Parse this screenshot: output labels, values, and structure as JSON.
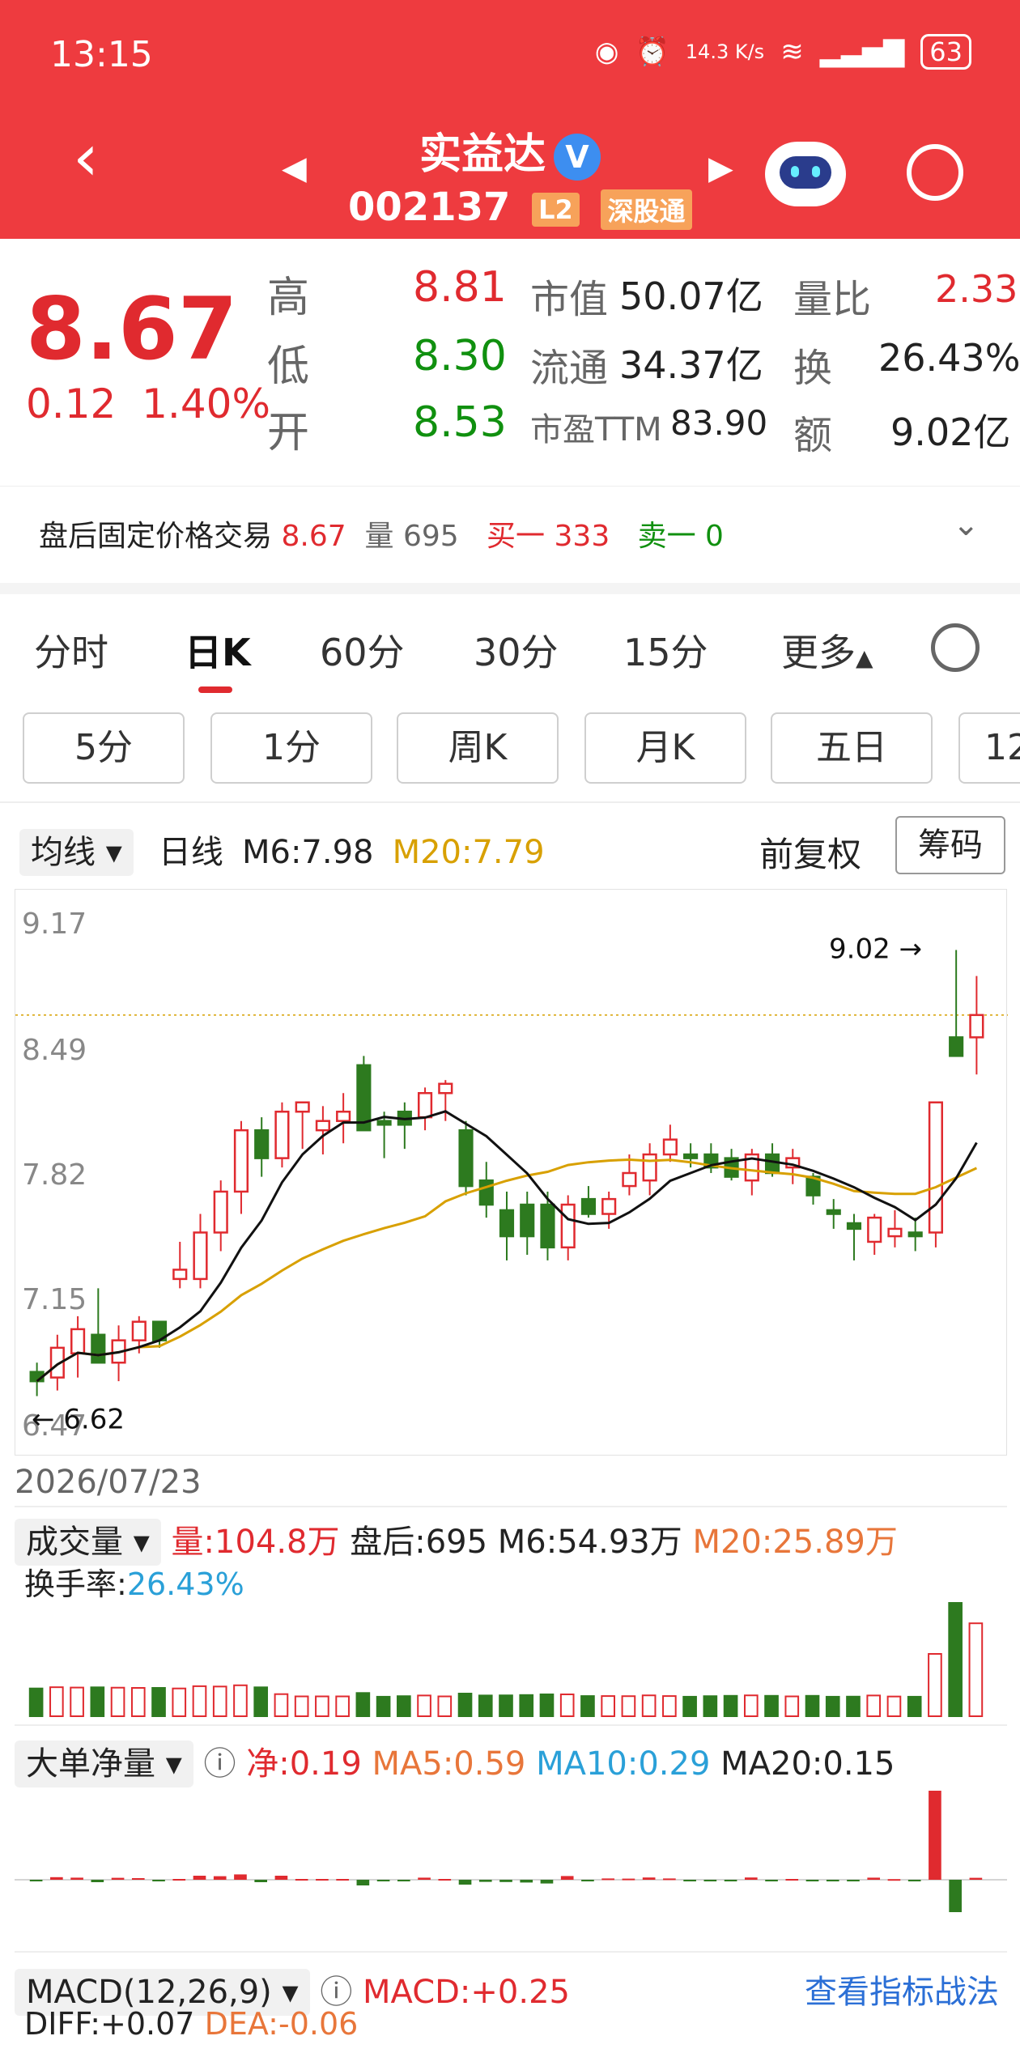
{
  "status_bar": {
    "time": "13:15",
    "network_speed": "14.3 K/s",
    "battery": "63"
  },
  "header": {
    "name": "实益达",
    "code": "002137",
    "tag_l2": "L2",
    "tag_connect": "深股通"
  },
  "quote": {
    "price": "8.67",
    "change": "0.12",
    "change_pct": "1.40%",
    "high_label": "高",
    "high": "8.81",
    "low_label": "低",
    "low": "8.30",
    "open_label": "开",
    "open": "8.53",
    "mcap_label": "市值",
    "mcap": "50.07亿",
    "float_label": "流通",
    "float": "34.37亿",
    "pe_label": "市盈TTM",
    "pe": "83.90",
    "vol_ratio_label": "量比",
    "vol_ratio": "2.33",
    "turnover_label": "换",
    "turnover": "26.43%",
    "amount_label": "额",
    "amount": "9.02亿"
  },
  "after_hours": {
    "label": "盘后固定价格交易",
    "price": "8.67",
    "vol_label": "量",
    "vol": "695",
    "buy1_label": "买一",
    "buy1": "333",
    "sell1_label": "卖一",
    "sell1": "0"
  },
  "tabs": [
    "分时",
    "日K",
    "60分",
    "30分",
    "15分",
    "更多"
  ],
  "subtabs": [
    "5分",
    "1分",
    "周K",
    "月K",
    "五日",
    "12"
  ],
  "kline": {
    "ma_dropdown": "均线",
    "line_type": "日线",
    "m6": "M6:7.98",
    "m20": "M20:7.79",
    "adjust": "前复权",
    "chip_btn": "筹码",
    "y_ticks": [
      "9.17",
      "8.49",
      "7.82",
      "7.15",
      "6.47"
    ],
    "high_mark": "9.02",
    "low_mark": "6.62",
    "date": "2026/07/23",
    "colors": {
      "up": "#e02a2f",
      "down": "#2d7a1f",
      "ma6": "#111111",
      "ma20": "#d8a000"
    }
  },
  "volume": {
    "dropdown": "成交量",
    "vol": "量:104.8万",
    "after": "盘后:695",
    "m6": "M6:54.93万",
    "m20": "M20:25.89万",
    "turnover_label": "换手率:",
    "turnover": "26.43%"
  },
  "bigorder": {
    "dropdown": "大单净量",
    "net": "净:0.19",
    "ma5": "MA5:0.59",
    "ma10": "MA10:0.29",
    "ma20": "MA20:0.15"
  },
  "macd": {
    "dropdown": "MACD(12,26,9)",
    "value": "MACD:+0.25",
    "link": "查看指标战法",
    "diff": "DIFF:+0.07",
    "dea": "DEA:-0.06"
  },
  "chart_data": {
    "type": "candlestick",
    "series": [
      {
        "o": 6.75,
        "h": 6.8,
        "l": 6.62,
        "c": 6.7
      },
      {
        "o": 6.72,
        "h": 6.95,
        "l": 6.65,
        "c": 6.88
      },
      {
        "o": 6.85,
        "h": 7.05,
        "l": 6.72,
        "c": 6.98
      },
      {
        "o": 6.95,
        "h": 7.2,
        "l": 6.8,
        "c": 6.8
      },
      {
        "o": 6.8,
        "h": 7.0,
        "l": 6.7,
        "c": 6.92
      },
      {
        "o": 6.92,
        "h": 7.05,
        "l": 6.85,
        "c": 7.02
      },
      {
        "o": 7.02,
        "h": 7.0,
        "l": 6.88,
        "c": 6.92
      },
      {
        "o": 7.25,
        "h": 7.45,
        "l": 7.2,
        "c": 7.3
      },
      {
        "o": 7.25,
        "h": 7.6,
        "l": 7.2,
        "c": 7.5
      },
      {
        "o": 7.5,
        "h": 7.78,
        "l": 7.4,
        "c": 7.72
      },
      {
        "o": 7.72,
        "h": 8.1,
        "l": 7.6,
        "c": 8.05
      },
      {
        "o": 8.05,
        "h": 8.12,
        "l": 7.8,
        "c": 7.9
      },
      {
        "o": 7.9,
        "h": 8.2,
        "l": 7.85,
        "c": 8.15
      },
      {
        "o": 8.15,
        "h": 8.2,
        "l": 7.95,
        "c": 8.2
      },
      {
        "o": 8.05,
        "h": 8.18,
        "l": 7.92,
        "c": 8.1
      },
      {
        "o": 8.1,
        "h": 8.25,
        "l": 7.98,
        "c": 8.15
      },
      {
        "o": 8.4,
        "h": 8.45,
        "l": 8.05,
        "c": 8.05
      },
      {
        "o": 8.1,
        "h": 8.15,
        "l": 7.9,
        "c": 8.08
      },
      {
        "o": 8.15,
        "h": 8.2,
        "l": 7.95,
        "c": 8.08
      },
      {
        "o": 8.12,
        "h": 8.28,
        "l": 8.05,
        "c": 8.25
      },
      {
        "o": 8.25,
        "h": 8.32,
        "l": 8.1,
        "c": 8.3
      },
      {
        "o": 8.05,
        "h": 8.1,
        "l": 7.7,
        "c": 7.75
      },
      {
        "o": 7.78,
        "h": 7.88,
        "l": 7.58,
        "c": 7.65
      },
      {
        "o": 7.62,
        "h": 7.72,
        "l": 7.35,
        "c": 7.48
      },
      {
        "o": 7.65,
        "h": 7.72,
        "l": 7.38,
        "c": 7.48
      },
      {
        "o": 7.65,
        "h": 7.72,
        "l": 7.35,
        "c": 7.42
      },
      {
        "o": 7.42,
        "h": 7.7,
        "l": 7.35,
        "c": 7.65
      },
      {
        "o": 7.68,
        "h": 7.75,
        "l": 7.58,
        "c": 7.6
      },
      {
        "o": 7.6,
        "h": 7.72,
        "l": 7.52,
        "c": 7.68
      },
      {
        "o": 7.75,
        "h": 7.92,
        "l": 7.7,
        "c": 7.82
      },
      {
        "o": 7.78,
        "h": 7.98,
        "l": 7.7,
        "c": 7.92
      },
      {
        "o": 7.92,
        "h": 8.08,
        "l": 7.88,
        "c": 8.0
      },
      {
        "o": 7.92,
        "h": 7.98,
        "l": 7.85,
        "c": 7.9
      },
      {
        "o": 7.92,
        "h": 7.98,
        "l": 7.82,
        "c": 7.85
      },
      {
        "o": 7.9,
        "h": 7.95,
        "l": 7.78,
        "c": 7.8
      },
      {
        "o": 7.78,
        "h": 7.95,
        "l": 7.7,
        "c": 7.92
      },
      {
        "o": 7.92,
        "h": 7.98,
        "l": 7.8,
        "c": 7.82
      },
      {
        "o": 7.85,
        "h": 7.95,
        "l": 7.76,
        "c": 7.9
      },
      {
        "o": 7.8,
        "h": 7.82,
        "l": 7.65,
        "c": 7.7
      },
      {
        "o": 7.62,
        "h": 7.68,
        "l": 7.52,
        "c": 7.6
      },
      {
        "o": 7.55,
        "h": 7.6,
        "l": 7.35,
        "c": 7.52
      },
      {
        "o": 7.45,
        "h": 7.6,
        "l": 7.38,
        "c": 7.58
      },
      {
        "o": 7.48,
        "h": 7.62,
        "l": 7.42,
        "c": 7.52
      },
      {
        "o": 7.5,
        "h": 7.58,
        "l": 7.4,
        "c": 7.48
      },
      {
        "o": 7.5,
        "h": 8.2,
        "l": 7.42,
        "c": 8.2
      },
      {
        "o": 8.55,
        "h": 9.02,
        "l": 8.45,
        "c": 8.45
      },
      {
        "o": 8.55,
        "h": 8.88,
        "l": 8.35,
        "c": 8.67
      }
    ],
    "ylim": [
      6.47,
      9.17
    ]
  }
}
